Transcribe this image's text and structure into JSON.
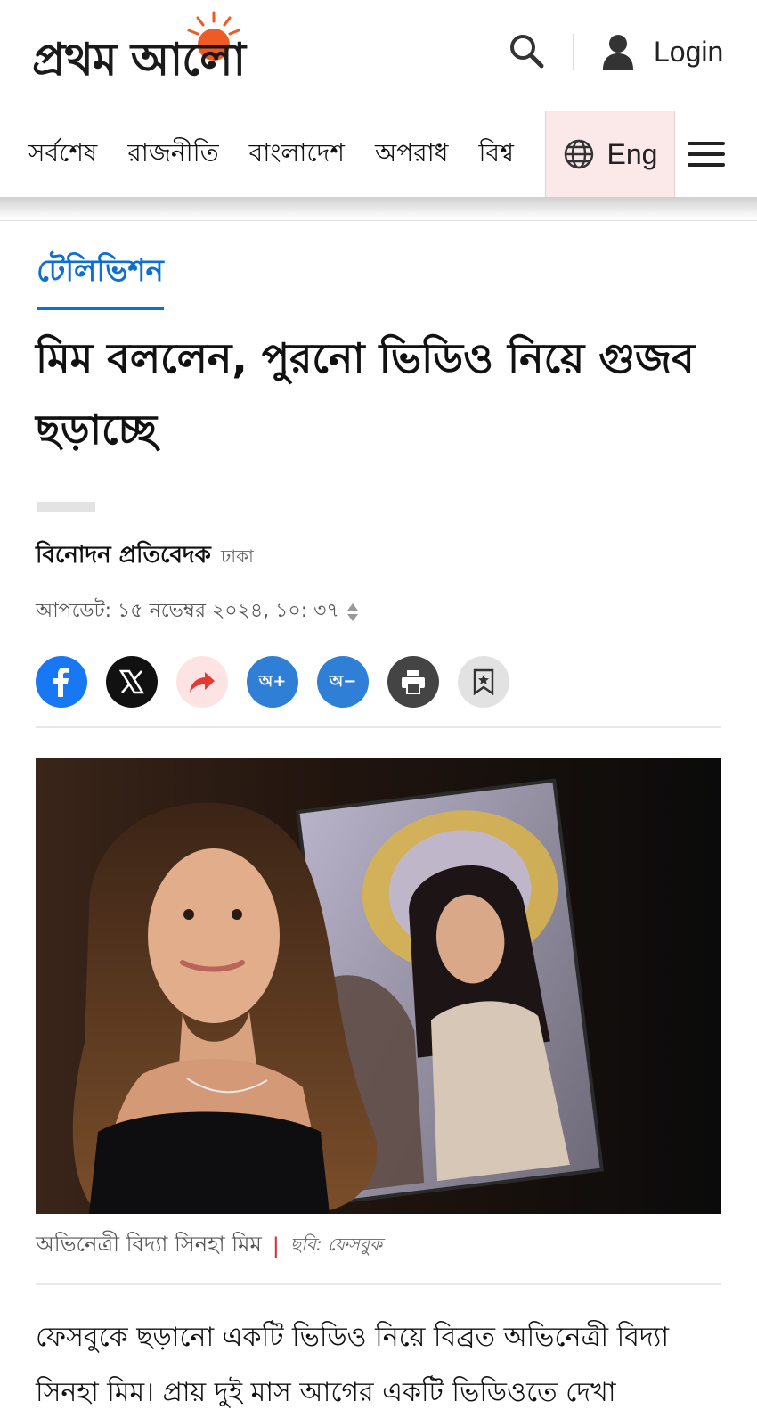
{
  "header": {
    "logo_text": "প্রথম আলো",
    "login_label": "Login",
    "icons": {
      "search": "search-icon",
      "user": "user-icon",
      "globe": "globe-icon",
      "menu": "hamburger-menu-icon"
    }
  },
  "nav": {
    "items": [
      "সর্বশেষ",
      "রাজনীতি",
      "বাংলাদেশ",
      "অপরাধ",
      "বিশ্ব"
    ],
    "lang_label": "Eng"
  },
  "article": {
    "section": "টেলিভিশন",
    "headline": "মিম বললেন, পুরনো ভিডিও নিয়ে গুজব ছড়াচ্ছে",
    "author": "বিনোদন প্রতিবেদক",
    "location": "ঢাকা",
    "updated": "আপডেট: ১৫ নভেম্বর ২০২৪, ১০: ৩৭",
    "share_buttons": [
      {
        "name": "facebook",
        "icon": "facebook-icon",
        "color": "#1877f2"
      },
      {
        "name": "x",
        "icon": "x-icon",
        "color": "#111111"
      },
      {
        "name": "share",
        "icon": "share-arrow-icon",
        "color": "#fde3e3"
      },
      {
        "name": "font-increase",
        "label": "অ+",
        "color": "#2f7fd6"
      },
      {
        "name": "font-decrease",
        "label": "অ−",
        "color": "#2f7fd6"
      },
      {
        "name": "print",
        "icon": "print-icon",
        "color": "#444444"
      },
      {
        "name": "bookmark",
        "icon": "bookmark-icon",
        "color": "#e2e2e2"
      }
    ],
    "image_caption": "অভিনেত্রী বিদ্যা সিনহা মিম",
    "caption_separator": "|",
    "image_credit": "ছবি: ফেসবুক",
    "body": "ফেসবুকে ছড়ানো একটি ভিডিও নিয়ে বিব্রত অভিনেত্রী বিদ্যা সিনহা মিম। প্রায় দুই মাস আগের একটি ভিডিওতে দেখা"
  },
  "colors": {
    "accent": "#0d6fd1",
    "logo_sun": "#f05a24",
    "lang_bg": "#fbe9e9"
  }
}
